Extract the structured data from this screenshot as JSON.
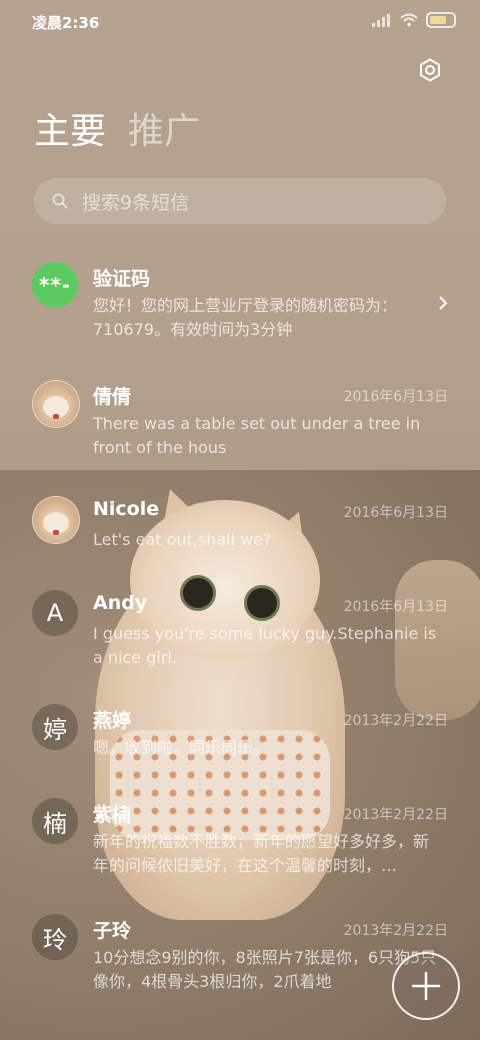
{
  "status_bar": {
    "time": "凌晨2:36"
  },
  "tabs": [
    {
      "label": "主要",
      "active": true
    },
    {
      "label": "推广",
      "active": false
    }
  ],
  "search": {
    "placeholder": "搜索9条短信"
  },
  "messages": [
    {
      "avatar_type": "badge",
      "avatar_text": "**-",
      "avatar_color": "#5ccb5f",
      "name": "验证码",
      "date": "",
      "preview": "您好！您的网上营业厅登录的随机密码为：710679。有效时间为3分钟",
      "has_chevron": true
    },
    {
      "avatar_type": "photo",
      "avatar_text": "",
      "name": "倩倩",
      "date": "2016年6月13日",
      "preview": "There was a table set out under a tree in front of the hous"
    },
    {
      "avatar_type": "photo",
      "avatar_text": "",
      "name": "Nicole",
      "date": "2016年6月13日",
      "preview": "Let's eat out,shall we?"
    },
    {
      "avatar_type": "letter",
      "avatar_text": "A",
      "name": "Andy",
      "date": "2016年6月13日",
      "preview": "I guess you're some lucky guy.Stephanie is a nice girl."
    },
    {
      "avatar_type": "letter",
      "avatar_text": "婷",
      "name": "燕婷",
      "date": "2013年2月22日",
      "preview": "嗯。收到啦。同乐同乐。"
    },
    {
      "avatar_type": "letter",
      "avatar_text": "楠",
      "name": "紫楠",
      "date": "2013年2月22日",
      "preview": "新年的祝福数不胜数，新年的愿望好多好多，新年的问候依旧美好，在这个温馨的时刻，…"
    },
    {
      "avatar_type": "letter",
      "avatar_text": "玲",
      "name": "子玲",
      "date": "2013年2月22日",
      "preview": "10分想念9别的你，8张照片7张是你，6只狗5只像你，4根骨头3根归你，2爪着地"
    }
  ],
  "icons": {
    "settings": "gear-icon",
    "search": "search-icon",
    "chevron": "chevron-right-icon",
    "compose": "plus-icon"
  },
  "colors": {
    "accent_green": "#5ccb5f",
    "background": "#b3a08c"
  }
}
